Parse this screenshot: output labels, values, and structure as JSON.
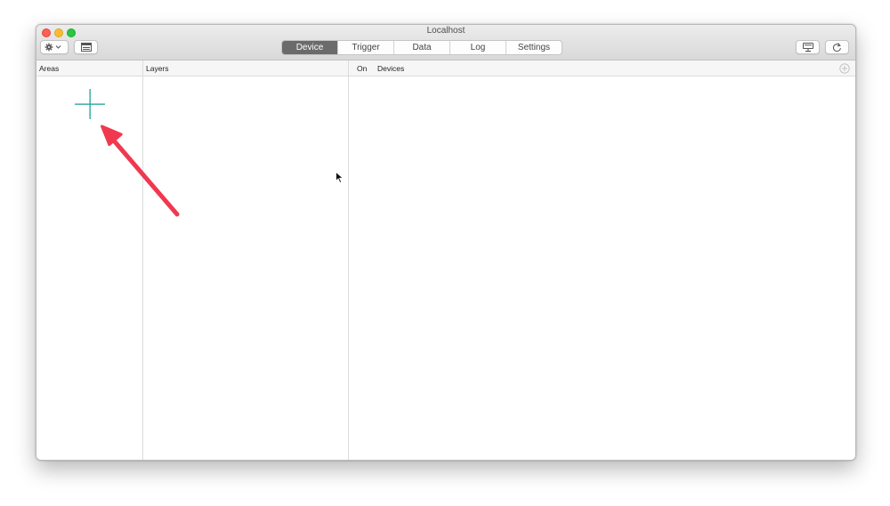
{
  "window": {
    "title": "Localhost"
  },
  "toolbar": {
    "tabs": [
      {
        "label": "Device",
        "active": true
      },
      {
        "label": "Trigger",
        "active": false
      },
      {
        "label": "Data",
        "active": false
      },
      {
        "label": "Log",
        "active": false
      },
      {
        "label": "Settings",
        "active": false
      }
    ]
  },
  "columns": {
    "areas": "Areas",
    "layers": "Layers",
    "on": "On",
    "devices": "Devices"
  },
  "colors": {
    "accent_plus": "#1fa396",
    "annotation_arrow": "#f0384f",
    "active_tab": "#6b6b6b"
  },
  "icons": [
    "gear-icon",
    "chevron-down-icon",
    "panel-toggle-icon",
    "display-icon",
    "refresh-icon",
    "add-circle-icon",
    "add-area-plus-icon",
    "mouse-cursor-icon"
  ]
}
